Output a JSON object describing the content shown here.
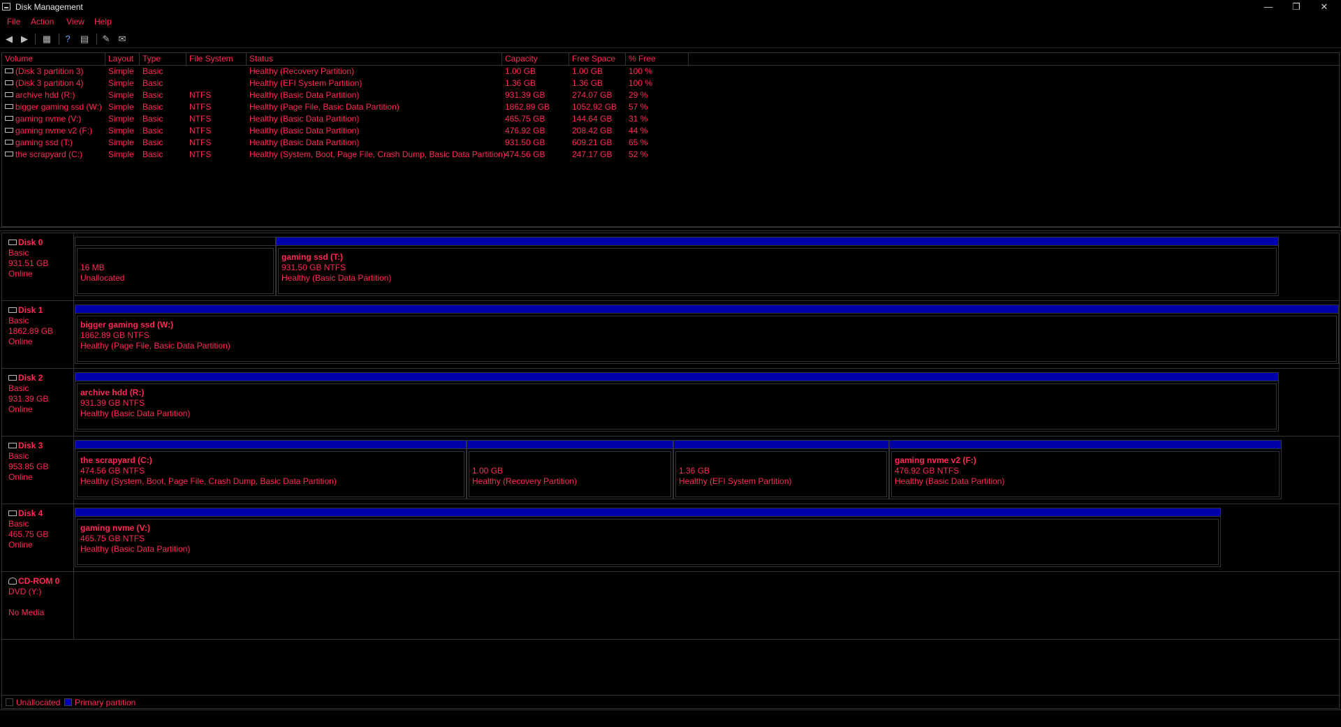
{
  "window": {
    "title": "Disk Management"
  },
  "menu": [
    "File",
    "Action",
    "View",
    "Help"
  ],
  "volume_list": {
    "columns": [
      "Volume",
      "Layout",
      "Type",
      "File System",
      "Status",
      "Capacity",
      "Free Space",
      "% Free"
    ],
    "rows": [
      [
        "(Disk 3 partition 3)",
        "Simple",
        "Basic",
        "",
        "Healthy (Recovery Partition)",
        "1.00 GB",
        "1.00 GB",
        "100 %"
      ],
      [
        "(Disk 3 partition 4)",
        "Simple",
        "Basic",
        "",
        "Healthy (EFI System Partition)",
        "1.36 GB",
        "1.36 GB",
        "100 %"
      ],
      [
        "archive hdd (R:)",
        "Simple",
        "Basic",
        "NTFS",
        "Healthy (Basic Data Partition)",
        "931.39 GB",
        "274.07 GB",
        "29 %"
      ],
      [
        "bigger gaming ssd (W:)",
        "Simple",
        "Basic",
        "NTFS",
        "Healthy (Page File, Basic Data Partition)",
        "1862.89 GB",
        "1052.92 GB",
        "57 %"
      ],
      [
        "gaming nvme (V:)",
        "Simple",
        "Basic",
        "NTFS",
        "Healthy (Basic Data Partition)",
        "465.75 GB",
        "144.64 GB",
        "31 %"
      ],
      [
        "gaming nvme v2 (F:)",
        "Simple",
        "Basic",
        "NTFS",
        "Healthy (Basic Data Partition)",
        "476.92 GB",
        "208.42 GB",
        "44 %"
      ],
      [
        "gaming ssd (T:)",
        "Simple",
        "Basic",
        "NTFS",
        "Healthy (Basic Data Partition)",
        "931.50 GB",
        "609.21 GB",
        "65 %"
      ],
      [
        "the scrapyard (C:)",
        "Simple",
        "Basic",
        "NTFS",
        "Healthy (System, Boot, Page File, Crash Dump, Basic Data Partition)",
        "474.56 GB",
        "247.17 GB",
        "52 %"
      ]
    ]
  },
  "disks": [
    {
      "name": "Disk 0",
      "type": "Basic",
      "size": "931.51 GB",
      "status": "Online",
      "partitions": [
        {
          "name": "",
          "size_fs": "16 MB",
          "status": "Unallocated",
          "kind": "unallocated"
        },
        {
          "name": "gaming ssd  (T:)",
          "size_fs": "931.50 GB NTFS",
          "status": "Healthy (Basic Data Partition)",
          "kind": "primary"
        }
      ]
    },
    {
      "name": "Disk 1",
      "type": "Basic",
      "size": "1862.89 GB",
      "status": "Online",
      "partitions": [
        {
          "name": "bigger gaming ssd  (W:)",
          "size_fs": "1862.89 GB NTFS",
          "status": "Healthy (Page File, Basic Data Partition)",
          "kind": "primary"
        }
      ]
    },
    {
      "name": "Disk 2",
      "type": "Basic",
      "size": "931.39 GB",
      "status": "Online",
      "partitions": [
        {
          "name": "archive hdd  (R:)",
          "size_fs": "931.39 GB NTFS",
          "status": "Healthy (Basic Data Partition)",
          "kind": "primary"
        }
      ]
    },
    {
      "name": "Disk 3",
      "type": "Basic",
      "size": "953.85 GB",
      "status": "Online",
      "partitions": [
        {
          "name": "the scrapyard  (C:)",
          "size_fs": "474.56 GB NTFS",
          "status": "Healthy (System, Boot, Page File, Crash Dump, Basic Data Partition)",
          "kind": "primary"
        },
        {
          "name": "",
          "size_fs": "1.00 GB",
          "status": "Healthy (Recovery Partition)",
          "kind": "primary"
        },
        {
          "name": "",
          "size_fs": "1.36 GB",
          "status": "Healthy (EFI System Partition)",
          "kind": "primary"
        },
        {
          "name": "gaming nvme v2  (F:)",
          "size_fs": "476.92 GB NTFS",
          "status": "Healthy (Basic Data Partition)",
          "kind": "primary"
        }
      ]
    },
    {
      "name": "Disk 4",
      "type": "Basic",
      "size": "465.75 GB",
      "status": "Online",
      "partitions": [
        {
          "name": "gaming nvme  (V:)",
          "size_fs": "465.75 GB NTFS",
          "status": "Healthy (Basic Data Partition)",
          "kind": "primary"
        }
      ]
    }
  ],
  "cdrom": {
    "name": "CD-ROM 0",
    "drive": "DVD (Y:)",
    "media": "No Media"
  },
  "legend": {
    "unallocated": "Unallocated",
    "primary": "Primary partition"
  },
  "colors": {
    "text": "#ff2a55",
    "primary_bar": "#0000aa",
    "background": "#000000"
  }
}
